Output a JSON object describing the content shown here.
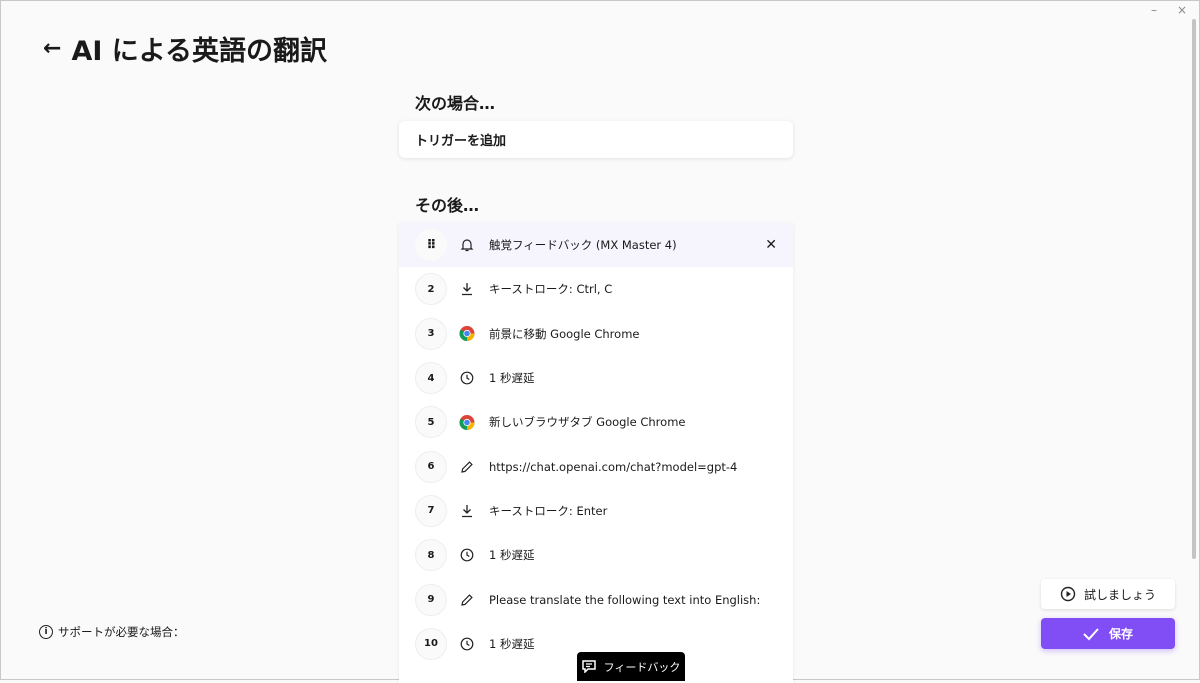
{
  "window": {
    "minimize": "–",
    "close": "×"
  },
  "header": {
    "back": "←",
    "title": "AI による英語の翻訳"
  },
  "when": {
    "heading": "次の場合…",
    "trigger": "トリガーを追加"
  },
  "then": {
    "heading": "その後…"
  },
  "steps": [
    {
      "num": "",
      "icon": "bell",
      "label": "触覚フィードバック (MX Master 4)"
    },
    {
      "num": "2",
      "icon": "keystroke",
      "label": "キーストローク: Ctrl, C"
    },
    {
      "num": "3",
      "icon": "chrome",
      "label": "前景に移動 Google Chrome"
    },
    {
      "num": "4",
      "icon": "clock",
      "label": "1 秒遅延"
    },
    {
      "num": "5",
      "icon": "chrome",
      "label": "新しいブラウザタブ Google Chrome"
    },
    {
      "num": "6",
      "icon": "pencil",
      "label": "https://chat.openai.com/chat?model=gpt-4"
    },
    {
      "num": "7",
      "icon": "keystroke",
      "label": "キーストローク: Enter"
    },
    {
      "num": "8",
      "icon": "clock",
      "label": "1 秒遅延"
    },
    {
      "num": "9",
      "icon": "pencil",
      "label": "Please translate the following text into English:"
    },
    {
      "num": "10",
      "icon": "clock",
      "label": "1 秒遅延"
    }
  ],
  "support": {
    "icon": "i",
    "label": "サポートが必要な場合："
  },
  "buttons": {
    "try": "試しましょう",
    "save": "保存",
    "feedback": "フィードバック"
  },
  "colors": {
    "accent": "#814ef6",
    "active_row": "#f6f4fd"
  }
}
